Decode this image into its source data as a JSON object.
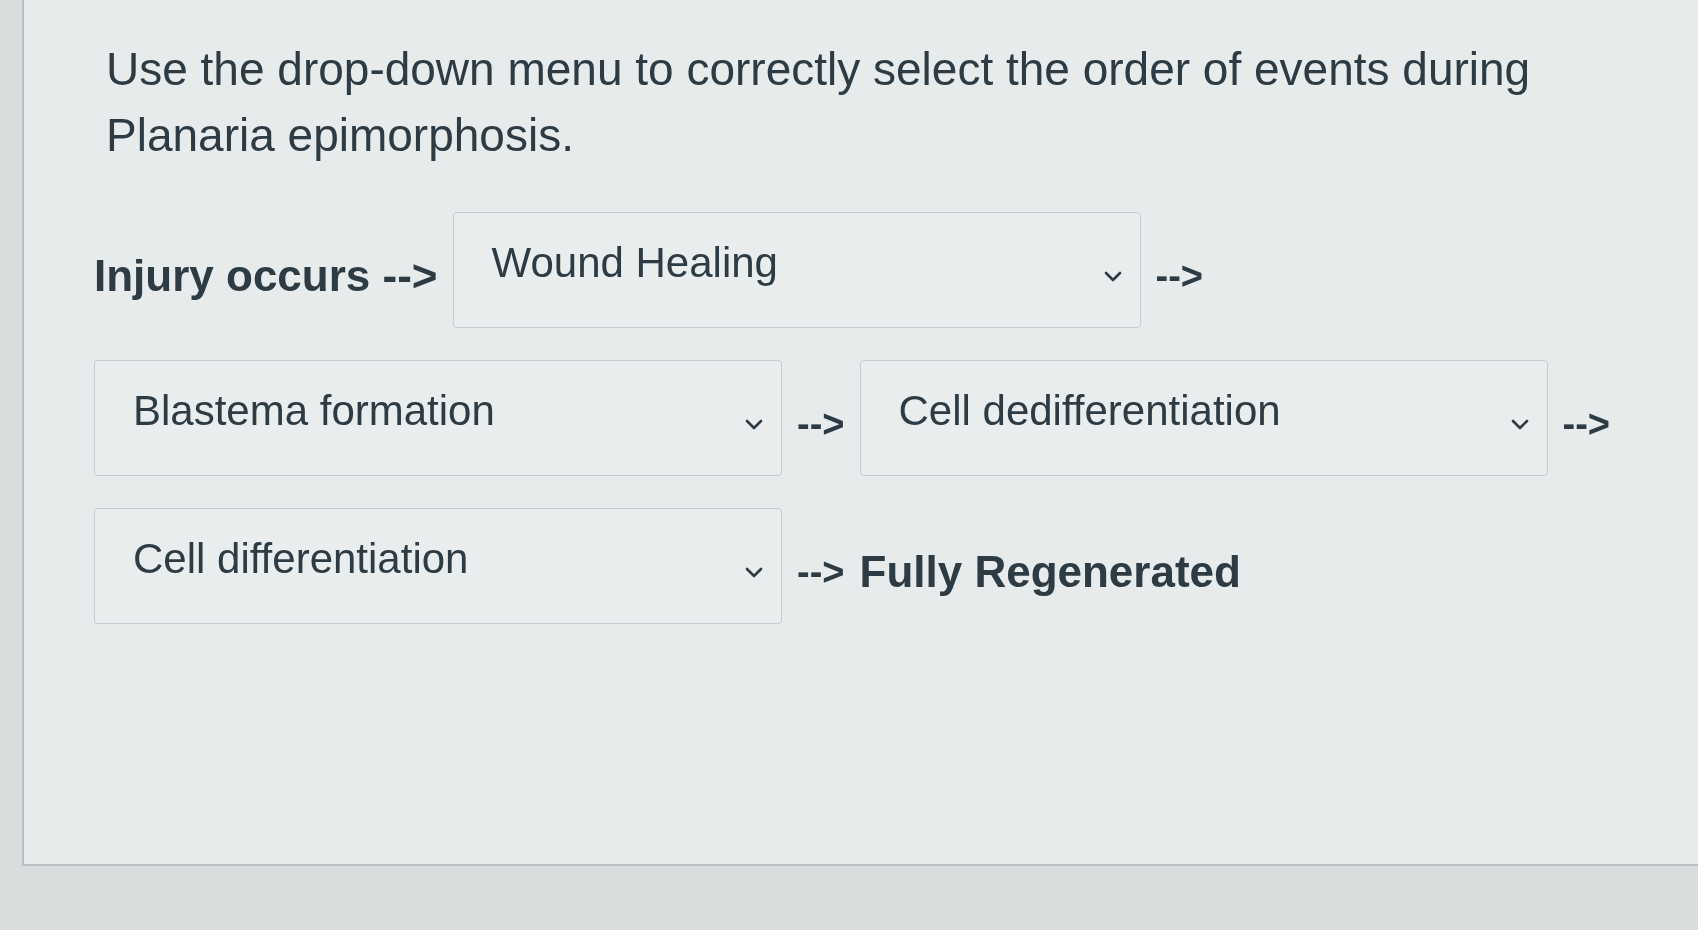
{
  "question": {
    "prompt": "Use the drop-down menu to correctly select the order of events during Planaria epimorphosis."
  },
  "sequence": [
    {
      "kind": "label",
      "text": "Injury occurs -->"
    },
    {
      "kind": "dropdown",
      "value": "Wound Healing"
    },
    {
      "kind": "arrow",
      "text": "-->"
    },
    {
      "kind": "dropdown",
      "value": "Blastema formation"
    },
    {
      "kind": "arrow",
      "text": "-->"
    },
    {
      "kind": "dropdown",
      "value": "Cell dedifferentiation"
    },
    {
      "kind": "arrow",
      "text": "-->"
    },
    {
      "kind": "dropdown",
      "value": "Cell differentiation"
    },
    {
      "kind": "arrow",
      "text": "-->"
    },
    {
      "kind": "label",
      "text": "Fully Regenerated"
    }
  ]
}
